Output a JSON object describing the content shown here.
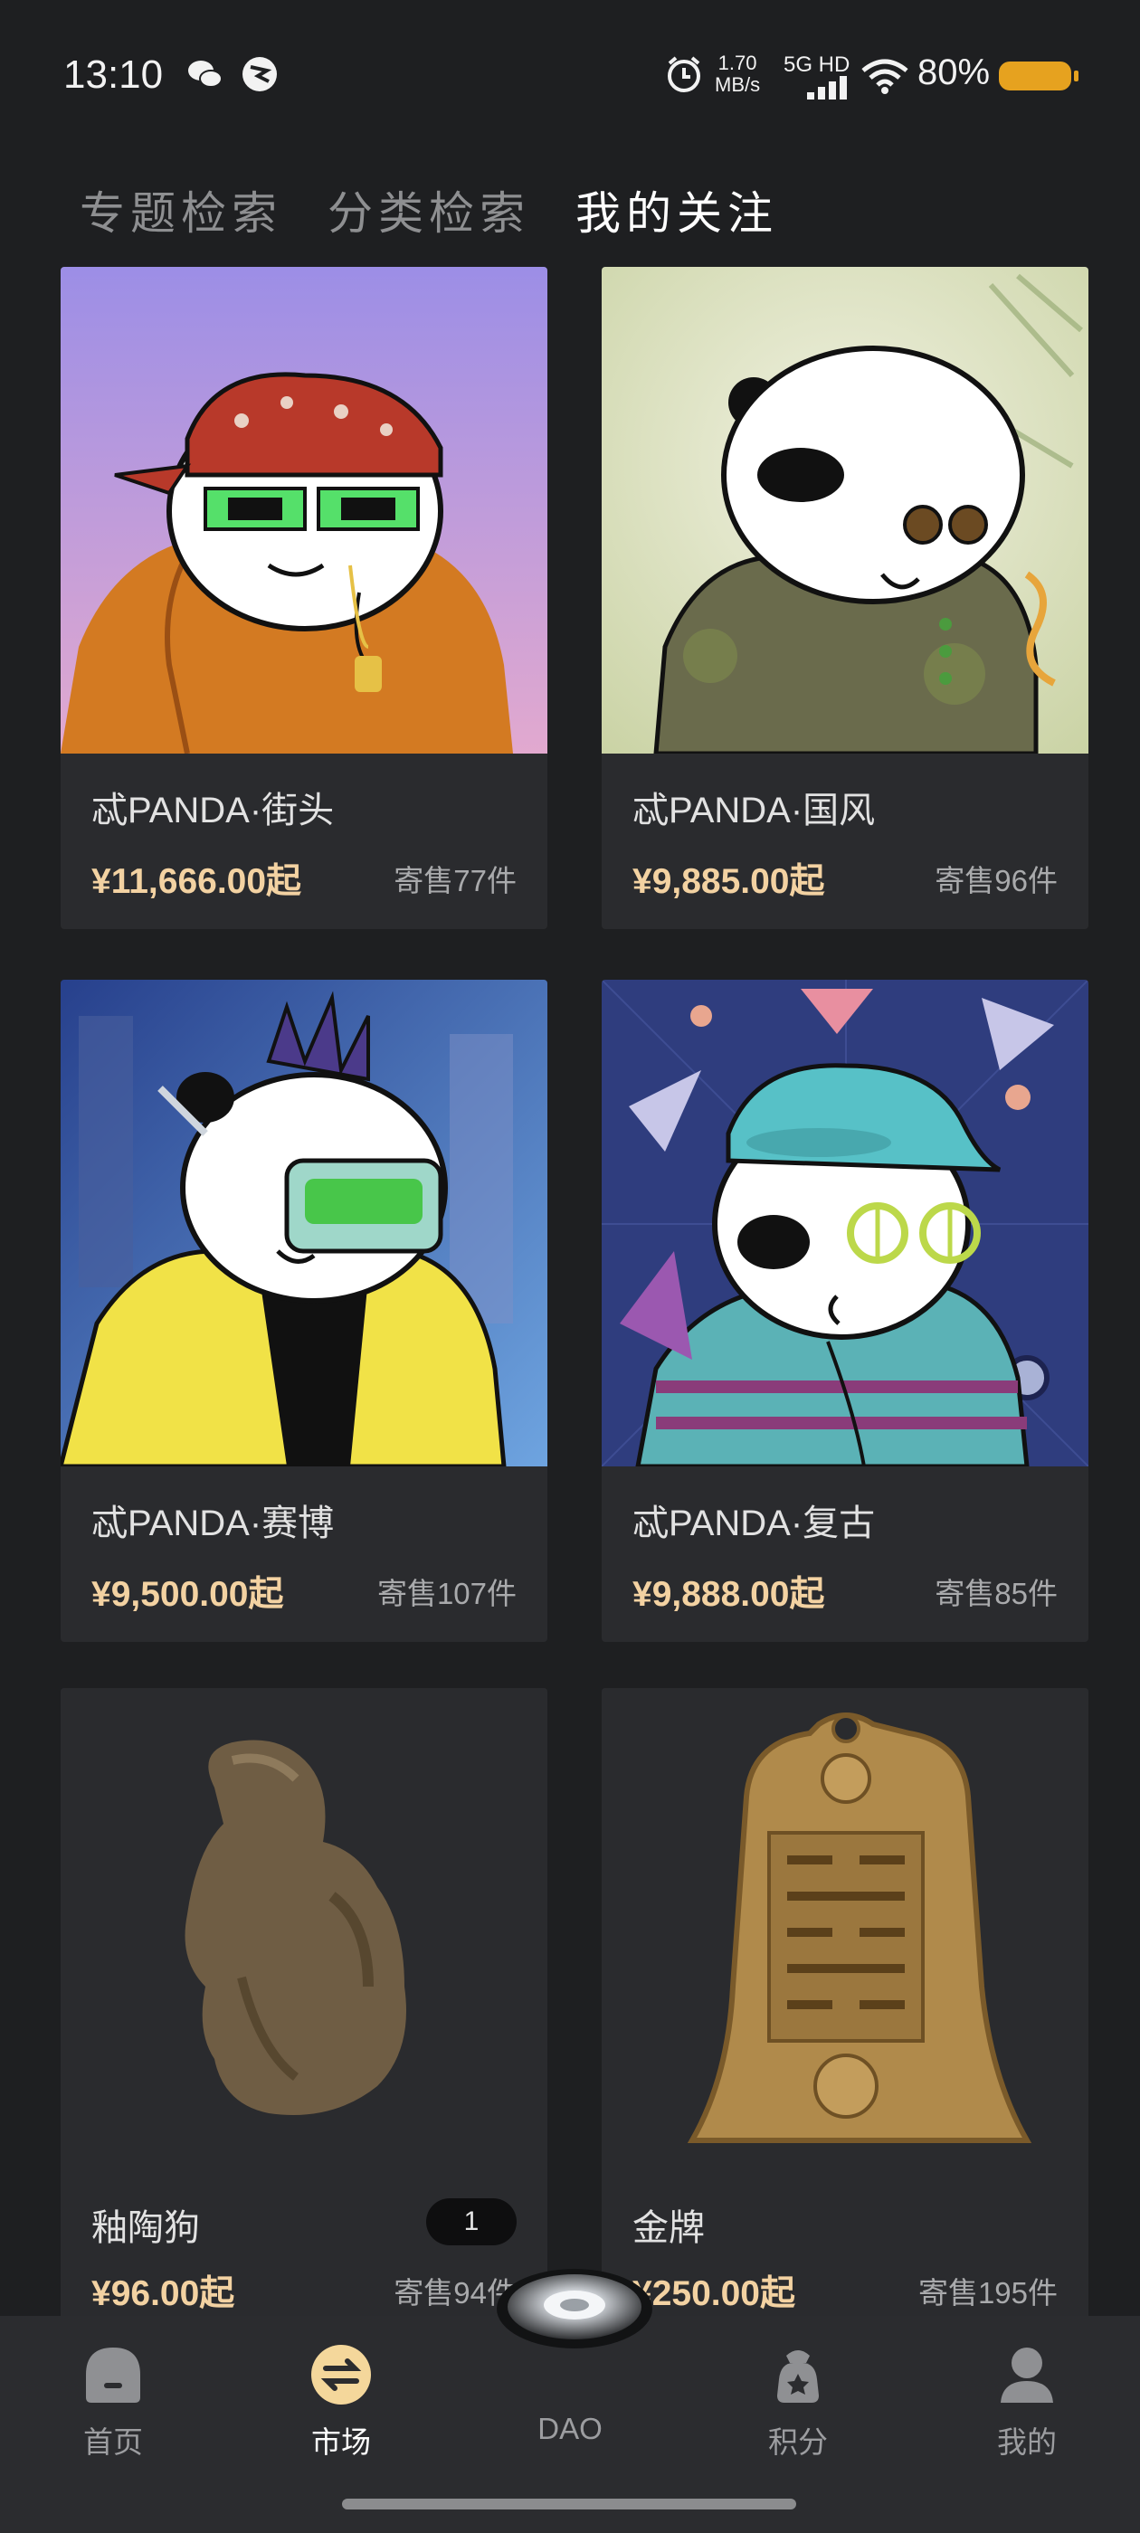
{
  "status_bar": {
    "time": "13:10",
    "net_speed_value": "1.70",
    "net_speed_unit": "MB/s",
    "network": "5G HD",
    "battery": "80%"
  },
  "tabs": [
    {
      "label": "专题检索"
    },
    {
      "label": "分类检索"
    },
    {
      "label": "我的关注"
    }
  ],
  "cards": [
    {
      "title": "忒PANDA·街头",
      "price": "¥11,666.00起",
      "stock": "寄售77件"
    },
    {
      "title": "忒PANDA·国风",
      "price": "¥9,885.00起",
      "stock": "寄售96件"
    },
    {
      "title": "忒PANDA·赛博",
      "price": "¥9,500.00起",
      "stock": "寄售107件"
    },
    {
      "title": "忒PANDA·复古",
      "price": "¥9,888.00起",
      "stock": "寄售85件"
    },
    {
      "title": "釉陶狗",
      "price": "¥96.00起",
      "stock": "寄售94件",
      "badge": "1"
    },
    {
      "title": "金牌",
      "price": "¥250.00起",
      "stock": "寄售195件"
    }
  ],
  "nav": [
    {
      "label": "首页",
      "icon": "home-icon"
    },
    {
      "label": "市场",
      "icon": "market-swap-icon"
    },
    {
      "label": "DAO",
      "icon": "dao-icon"
    },
    {
      "label": "积分",
      "icon": "points-bag-icon"
    },
    {
      "label": "我的",
      "icon": "profile-icon"
    }
  ],
  "colors": {
    "background": "#1e1f21",
    "card": "#2a2b2e",
    "price": "#f3d2a2",
    "market_accent": "#f4d79b",
    "battery": "#e6a21f"
  }
}
